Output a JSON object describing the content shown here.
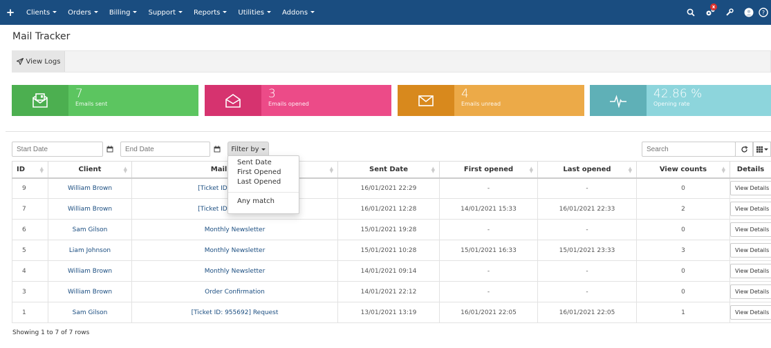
{
  "nav": {
    "items": [
      "Clients",
      "Orders",
      "Billing",
      "Support",
      "Reports",
      "Utilities",
      "Addons"
    ],
    "notification_badge": "x"
  },
  "page_title": "Mail Tracker",
  "view_logs_label": "View Logs",
  "stats": [
    {
      "value": "7",
      "label": "Emails sent",
      "icon_bg": "#4caf50",
      "body_bg": "#5cc560",
      "icon": "envelope-sent-icon"
    },
    {
      "value": "3",
      "label": "Emails opened",
      "icon_bg": "#d6336f",
      "body_bg": "#ec4b88",
      "icon": "envelope-open-icon"
    },
    {
      "value": "4",
      "label": "Emails unread",
      "icon_bg": "#d8891d",
      "body_bg": "#ecaa48",
      "icon": "envelope-icon"
    },
    {
      "value": "42.86 %",
      "label": "Opening rate",
      "icon_bg": "#5fb0b7",
      "body_bg": "#8dd5dc",
      "icon": "pulse-icon"
    }
  ],
  "toolbar": {
    "start_date_placeholder": "Start Date",
    "end_date_placeholder": "End Date",
    "filter_label": "Filter by",
    "search_placeholder": "Search"
  },
  "filter_menu": {
    "options": [
      "Sent Date",
      "First Opened",
      "Last Opened"
    ],
    "any_match": "Any match"
  },
  "table": {
    "headers": [
      "ID",
      "Client",
      "Mail Subject",
      "Sent Date",
      "First opened",
      "Last opened",
      "View counts",
      "Details"
    ],
    "rows": [
      [
        "9",
        "William Brown",
        "[Ticket ID: 476324] Can",
        "16/01/2021 22:29",
        "-",
        "-",
        "0",
        "View Details"
      ],
      [
        "7",
        "William Brown",
        "[Ticket ID: 476324] Can",
        "16/01/2021 12:28",
        "14/01/2021 15:33",
        "16/01/2021 22:33",
        "2",
        "View Details"
      ],
      [
        "6",
        "Sam Gilson",
        "Monthly Newsletter",
        "15/01/2021 19:28",
        "-",
        "-",
        "0",
        "View Details"
      ],
      [
        "5",
        "Liam Johnson",
        "Monthly Newsletter",
        "15/01/2021 10:28",
        "15/01/2021 16:33",
        "15/01/2021 23:33",
        "3",
        "View Details"
      ],
      [
        "4",
        "William Brown",
        "Monthly Newsletter",
        "14/01/2021 09:14",
        "-",
        "-",
        "0",
        "View Details"
      ],
      [
        "3",
        "William Brown",
        "Order Confirmation",
        "14/01/2021 22:12",
        "-",
        "-",
        "0",
        "View Details"
      ],
      [
        "1",
        "Sam Gilson",
        "[Ticket ID: 955692] Request",
        "13/01/2021 13:19",
        "16/01/2021 22:05",
        "16/01/2021 22:05",
        "1",
        "View Details"
      ]
    ]
  },
  "footer": "Showing 1 to 7 of 7 rows"
}
